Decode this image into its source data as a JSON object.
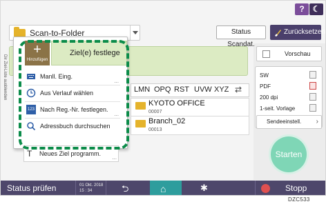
{
  "header": {
    "help_label": "?",
    "night_label": "☾",
    "function_select": "Scan-to-Folder",
    "status_scan_button": "Status Scandat.",
    "reset_button": "Zurücksetzen"
  },
  "side_tab": {
    "label": "Dir Ziel-Liste ausblenden"
  },
  "popup": {
    "add_label": "Hinzufügen",
    "add_symbol": "+",
    "target_button": "Ziel(e) festlege",
    "items": [
      {
        "label": "Manll. Eing.",
        "icon": "keyboard-icon"
      },
      {
        "label": "Aus Verlauf wählen",
        "icon": "clock-icon"
      },
      {
        "label": "Nach Reg.-Nr. festlegen.",
        "icon": "number-icon",
        "icon_text": "123"
      },
      {
        "label": "Adressbuch durchsuchen",
        "icon": "search-icon"
      }
    ],
    "new_destination": "Neues Ziel programm.",
    "more": "..."
  },
  "alpha_tabs": [
    "LMN",
    "OPQ",
    "RST",
    "UVW",
    "XYZ"
  ],
  "destinations": [
    {
      "name": "KYOTO OFFICE",
      "number": "00007"
    },
    {
      "name": "Branch_02",
      "number": "00013"
    }
  ],
  "right_panel": {
    "preview": "Vorschau",
    "settings": [
      "SW",
      "PDF",
      "200 dpi",
      "1-seit. Vorlage"
    ],
    "send_settings": "Sendeeinstell.",
    "start": "Starten"
  },
  "bottom_bar": {
    "status": "Status prüfen",
    "date": "01 Okt. 2018",
    "time": "15 : 34",
    "stop": "Stopp"
  },
  "figure_code": "DZC533",
  "colors": {
    "accent_purple": "#4e476b",
    "highlight_green": "#0c8c4a",
    "dest_green": "#dcebc3",
    "start_green": "#7fd6b6",
    "add_brown": "#8b7347"
  }
}
